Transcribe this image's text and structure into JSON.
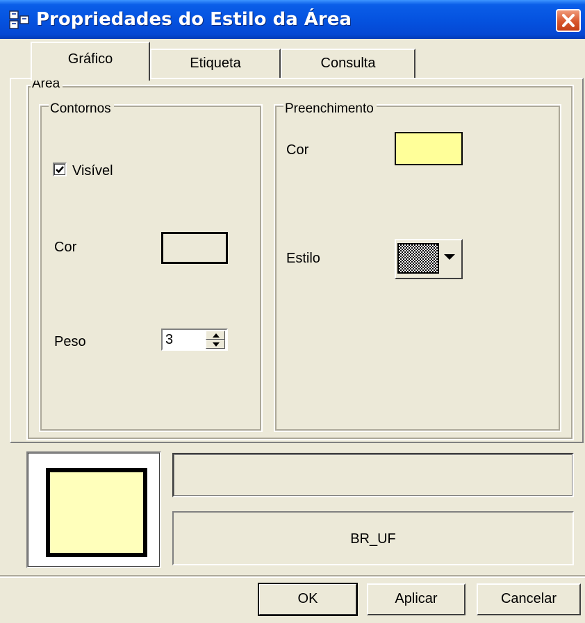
{
  "window": {
    "title": "Propriedades do Estilo da Área",
    "title_icon": "properties-grid-icon",
    "close_icon": "close-icon"
  },
  "tabs": [
    {
      "label": "Gráfico",
      "active": true
    },
    {
      "label": "Etiqueta",
      "active": false
    },
    {
      "label": "Consulta",
      "active": false
    }
  ],
  "area_group": {
    "label": "Área",
    "outlines": {
      "label": "Contornos",
      "visible_label": "Visível",
      "visible_checked": true,
      "color_label": "Cor",
      "color_value": "#ece9d8",
      "weight_label": "Peso",
      "weight_value": "3"
    },
    "fill": {
      "label": "Preenchimento",
      "color_label": "Cor",
      "color_value": "#ffff99",
      "style_label": "Estilo",
      "style_pattern": "checkerboard-fine"
    }
  },
  "preview": {
    "fill_color": "#ffffbb",
    "border_color": "#000000",
    "description": "",
    "name": "BR_UF"
  },
  "buttons": {
    "ok": "OK",
    "apply": "Aplicar",
    "cancel": "Cancelar"
  },
  "colors": {
    "titlebar_blue": "#0553e0",
    "dialog_bg": "#ece9d8",
    "close_red": "#d8582e"
  }
}
